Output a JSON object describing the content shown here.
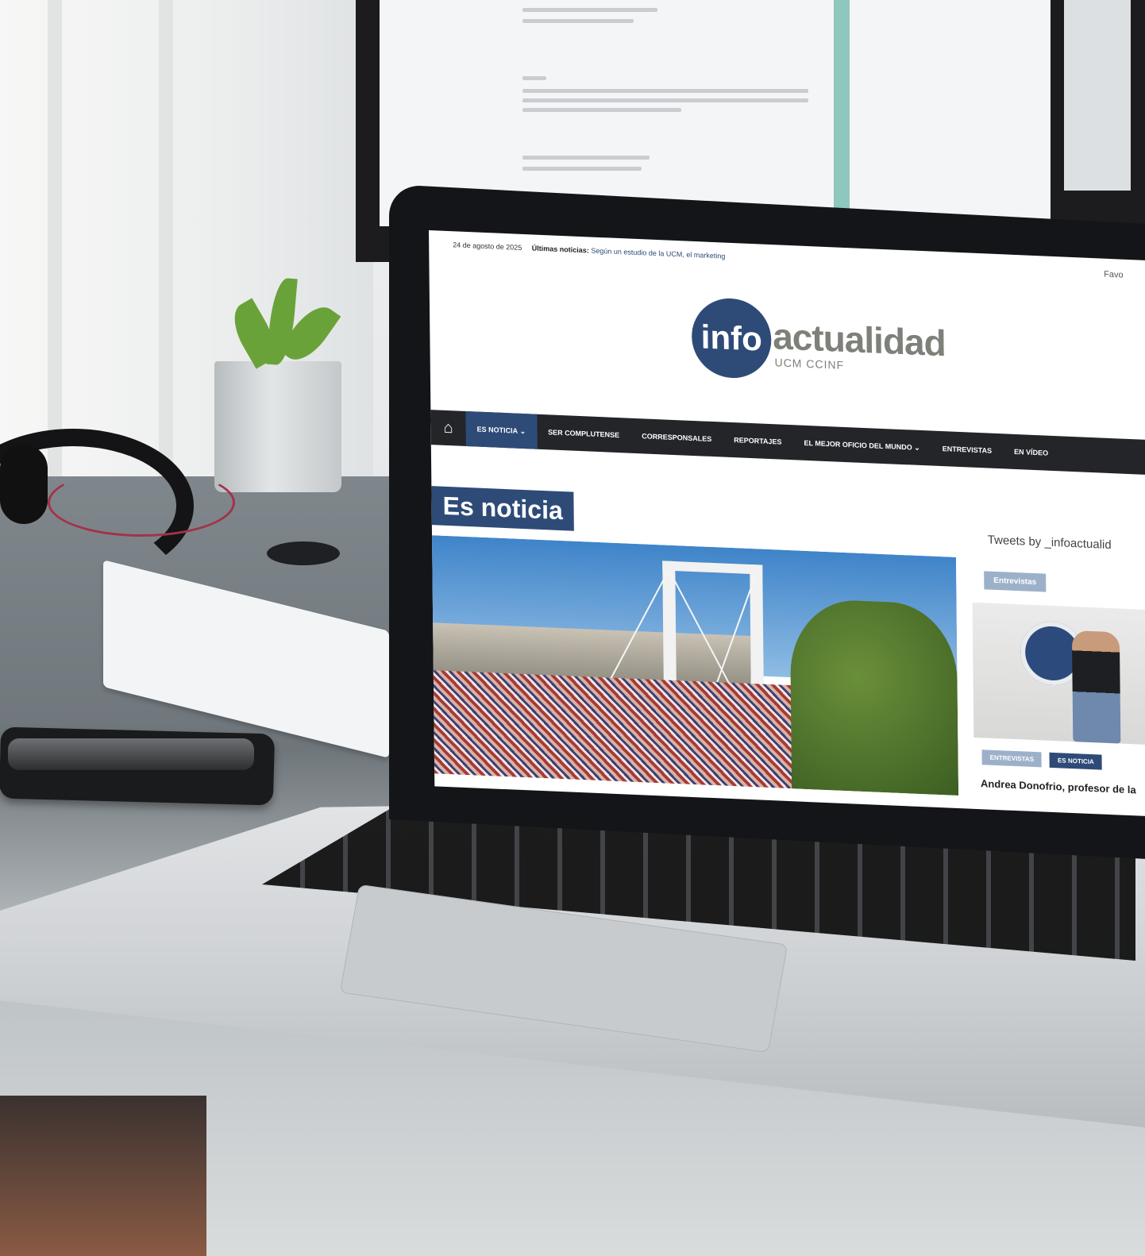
{
  "site": {
    "date": "24 de agosto de 2025",
    "ticker_label": "Últimas noticias:",
    "ticker_text": "Según un estudio de la UCM, el marketing",
    "favorites": "Favo",
    "logo_info": "info",
    "logo_name": "actualidad",
    "logo_sub": "UCM CCINF"
  },
  "nav": {
    "home_icon": "home-icon",
    "items": [
      {
        "label": "ES NOTICIA",
        "active": true,
        "has_dropdown": true
      },
      {
        "label": "SER COMPLUTENSE"
      },
      {
        "label": "CORRESPONSALES"
      },
      {
        "label": "REPORTAJES"
      },
      {
        "label": "EL MEJOR OFICIO DEL MUNDO",
        "has_dropdown": true
      },
      {
        "label": "ENTREVISTAS"
      },
      {
        "label": "EN VÍDEO"
      }
    ]
  },
  "main": {
    "section_title": "Es noticia"
  },
  "sidebar": {
    "tweets": "Tweets by _infoactualid",
    "tag": "Entrevistas",
    "badges": [
      "ENTREVISTAS",
      "ES NOTICIA"
    ],
    "headline": "Andrea Donofrio, profesor de la"
  },
  "colors": {
    "brand_navy": "#2e4b78",
    "logo_gray": "#7d8179",
    "accent_teal": "#8dc7bd",
    "nav_bg": "#232529"
  }
}
